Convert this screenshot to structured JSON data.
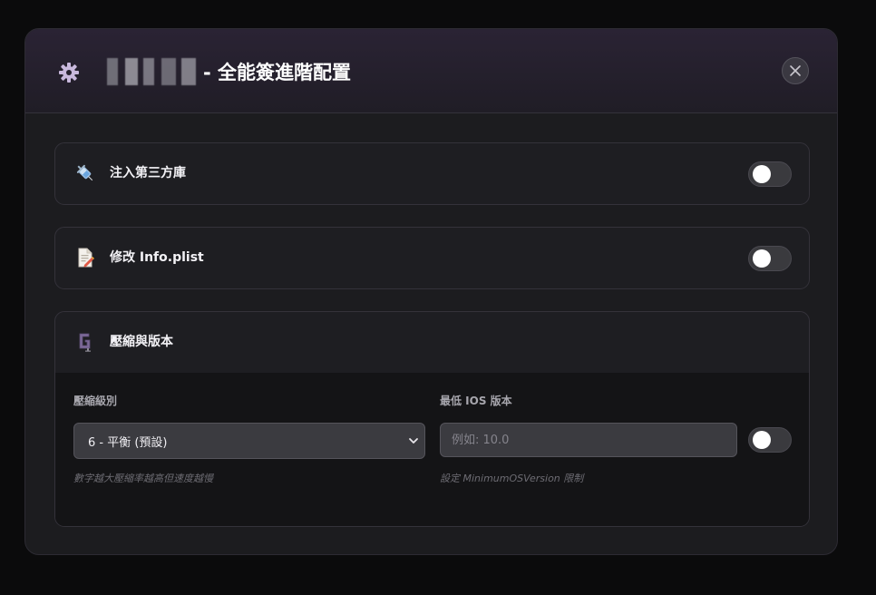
{
  "header": {
    "title_suffix": "- 全能簽進階配置",
    "icon": "gear-icon",
    "close_icon": "close-icon"
  },
  "sections": [
    {
      "label": "注入第三方庫",
      "icon": "syringe-icon",
      "toggle_on": false
    },
    {
      "label": "修改 Info.plist",
      "icon": "document-edit-icon",
      "toggle_on": false
    },
    {
      "label": "壓縮與版本",
      "icon": "clamp-icon"
    }
  ],
  "compression": {
    "label": "壓縮級別",
    "selected": "6 - 平衡 (預設)",
    "hint": "數字越大壓縮率越高但速度越慢"
  },
  "min_ios": {
    "label": "最低 IOS 版本",
    "value": "",
    "placeholder": "例如: 10.0",
    "hint": "設定 MinimumOSVersion 限制",
    "toggle_on": false
  },
  "colors": {
    "header_bg": "#2a2334",
    "panel_bg": "#1e1e22",
    "body_bg": "#141416",
    "toggle_off": "#3a3a3e"
  }
}
